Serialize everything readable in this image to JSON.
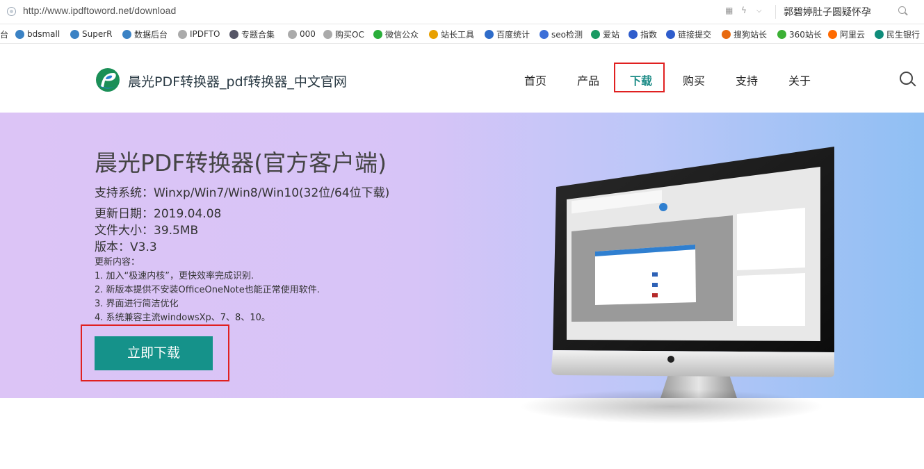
{
  "browser": {
    "url": "http://www.ipdftoword.net/download",
    "search_text": "郭碧婷肚子圆疑怀孕"
  },
  "bookmarks": [
    {
      "label": "台",
      "icon": "bookmark-icon",
      "color": "#999"
    },
    {
      "label": "bdsmall",
      "icon": "globe-icon",
      "color": "#3b82c4"
    },
    {
      "label": "SuperR",
      "icon": "globe-icon",
      "color": "#3b82c4"
    },
    {
      "label": "数据后台",
      "icon": "globe-icon",
      "color": "#3b82c4"
    },
    {
      "label": "IPDFTO",
      "icon": "page-icon",
      "color": "#aaa"
    },
    {
      "label": "专题合集",
      "icon": "globe-icon",
      "color": "#556"
    },
    {
      "label": "000",
      "icon": "page-icon",
      "color": "#aaa"
    },
    {
      "label": "购买OC",
      "icon": "page-icon",
      "color": "#aaa"
    },
    {
      "label": "微信公众",
      "icon": "wechat-icon",
      "color": "#2aae3a"
    },
    {
      "label": "站长工具",
      "icon": "tool-icon",
      "color": "#e8a000"
    },
    {
      "label": "百度统计",
      "icon": "chart-icon",
      "color": "#2f6cc9"
    },
    {
      "label": "seo检测",
      "icon": "seo-icon",
      "color": "#3d6fd8"
    },
    {
      "label": "爱站",
      "icon": "aizhan-icon",
      "color": "#1a9a63"
    },
    {
      "label": "指数",
      "icon": "baidu-paw-icon",
      "color": "#2f5dcc"
    },
    {
      "label": "链接提交",
      "icon": "baidu-paw-icon",
      "color": "#2f5dcc"
    },
    {
      "label": "搜狗站长",
      "icon": "sogou-icon",
      "color": "#e86a10"
    },
    {
      "label": "360站长",
      "icon": "360-icon",
      "color": "#3cb035"
    },
    {
      "label": "阿里云",
      "icon": "aliyun-icon",
      "color": "#ff6a00"
    },
    {
      "label": "民生银行",
      "icon": "bank-icon",
      "color": "#0f8c7a"
    }
  ],
  "header": {
    "brand": "晨光PDF转换器_pdf转换器_中文官网",
    "nav": [
      "首页",
      "产品",
      "下载",
      "购买",
      "支持",
      "关于"
    ],
    "active_nav": "下载"
  },
  "banner": {
    "title": "晨光PDF转换器(官方客户端)",
    "system": "支持系统：Winxp/Win7/Win8/Win10(32位/64位下载)",
    "date": "更新日期：2019.04.08",
    "size": "文件大小：39.5MB",
    "version": "版本：V3.3",
    "changes_title": "更新内容：",
    "changes": [
      "1. 加入“极速内核”，更快效率完成识别.",
      "2. 新版本提供不安装OfficeOneNote也能正常使用软件.",
      "3. 界面进行简洁优化",
      "4. 系统兼容主流windowsXp、7、8、10。"
    ],
    "download_button": "立即下载"
  },
  "colors": {
    "accent": "#15928a",
    "highlight_box": "#e02020",
    "banner_left": "#dcc4f6",
    "banner_right": "#8fbff3"
  }
}
